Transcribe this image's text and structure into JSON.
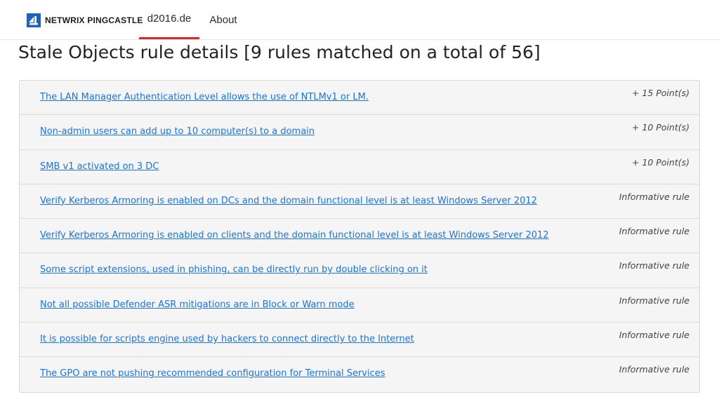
{
  "header": {
    "brand": "NETWRIX PINGCASTLE",
    "tabs": [
      {
        "label": "d2016.de",
        "active": true
      },
      {
        "label": "About",
        "active": false
      }
    ],
    "accent_color": "#d62a2a",
    "logo_color": "#1f5fbf"
  },
  "main": {
    "title": "Stale Objects rule details [9 rules matched on a total of 56]",
    "rules": [
      {
        "label": "The LAN Manager Authentication Level allows the use of NTLMv1 or LM.",
        "score": "+ 15 Point(s)"
      },
      {
        "label": "Non-admin users can add up to 10 computer(s) to a domain",
        "score": "+ 10 Point(s)"
      },
      {
        "label": "SMB v1 activated on 3 DC",
        "score": "+ 10 Point(s)"
      },
      {
        "label": "Verify Kerberos Armoring is enabled on DCs and the domain functional level is at least Windows Server 2012",
        "score": "Informative rule"
      },
      {
        "label": "Verify Kerberos Armoring is enabled on clients and the domain functional level is at least Windows Server 2012",
        "score": "Informative rule"
      },
      {
        "label": "Some script extensions, used in phishing, can be directly run by double clicking on it",
        "score": "Informative rule"
      },
      {
        "label": "Not all possible Defender ASR mitigations are in Block or Warn mode",
        "score": "Informative rule"
      },
      {
        "label": "It is possible for scripts engine used by hackers to connect directly to the Internet",
        "score": "Informative rule"
      },
      {
        "label": "The GPO are not pushing recommended configuration for Terminal Services",
        "score": "Informative rule"
      }
    ],
    "link_color": "#1a73e8"
  }
}
